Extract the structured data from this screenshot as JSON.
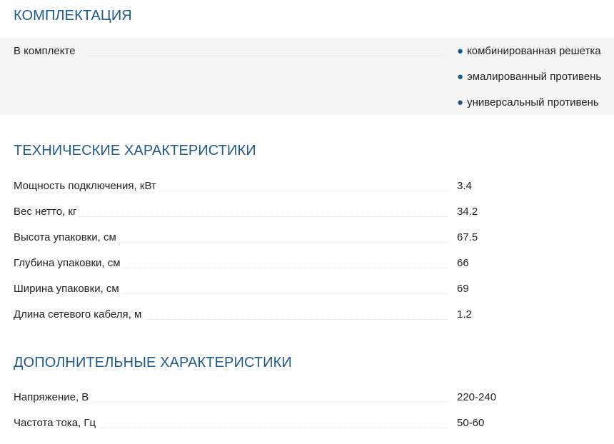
{
  "kit": {
    "title": "КОМПЛЕКТАЦИЯ",
    "label": "В комплекте",
    "items": [
      "комбинированная решетка",
      "эмалированный противень",
      "универсальный противень"
    ]
  },
  "technical": {
    "title": "ТЕХНИЧЕСКИЕ ХАРАКТЕРИСТИКИ",
    "rows": [
      {
        "label": "Мощность подключения, кВт",
        "value": "3.4"
      },
      {
        "label": "Вес нетто, кг",
        "value": "34.2"
      },
      {
        "label": "Высота упаковки, см",
        "value": "67.5"
      },
      {
        "label": "Глубина упаковки, см",
        "value": "66"
      },
      {
        "label": "Ширина упаковки, см",
        "value": "69"
      },
      {
        "label": "Длина сетевого кабеля, м",
        "value": "1.2"
      }
    ]
  },
  "additional": {
    "title": "ДОПОЛНИТЕЛЬНЫЕ ХАРАКТЕРИСТИКИ",
    "rows": [
      {
        "label": "Напряжение, В",
        "value": "220-240"
      },
      {
        "label": "Частота тока, Гц",
        "value": "50-60"
      }
    ]
  },
  "colors": {
    "heading": "#1e5a8c",
    "text": "#222222",
    "kit_background": "#f5f5f5"
  }
}
